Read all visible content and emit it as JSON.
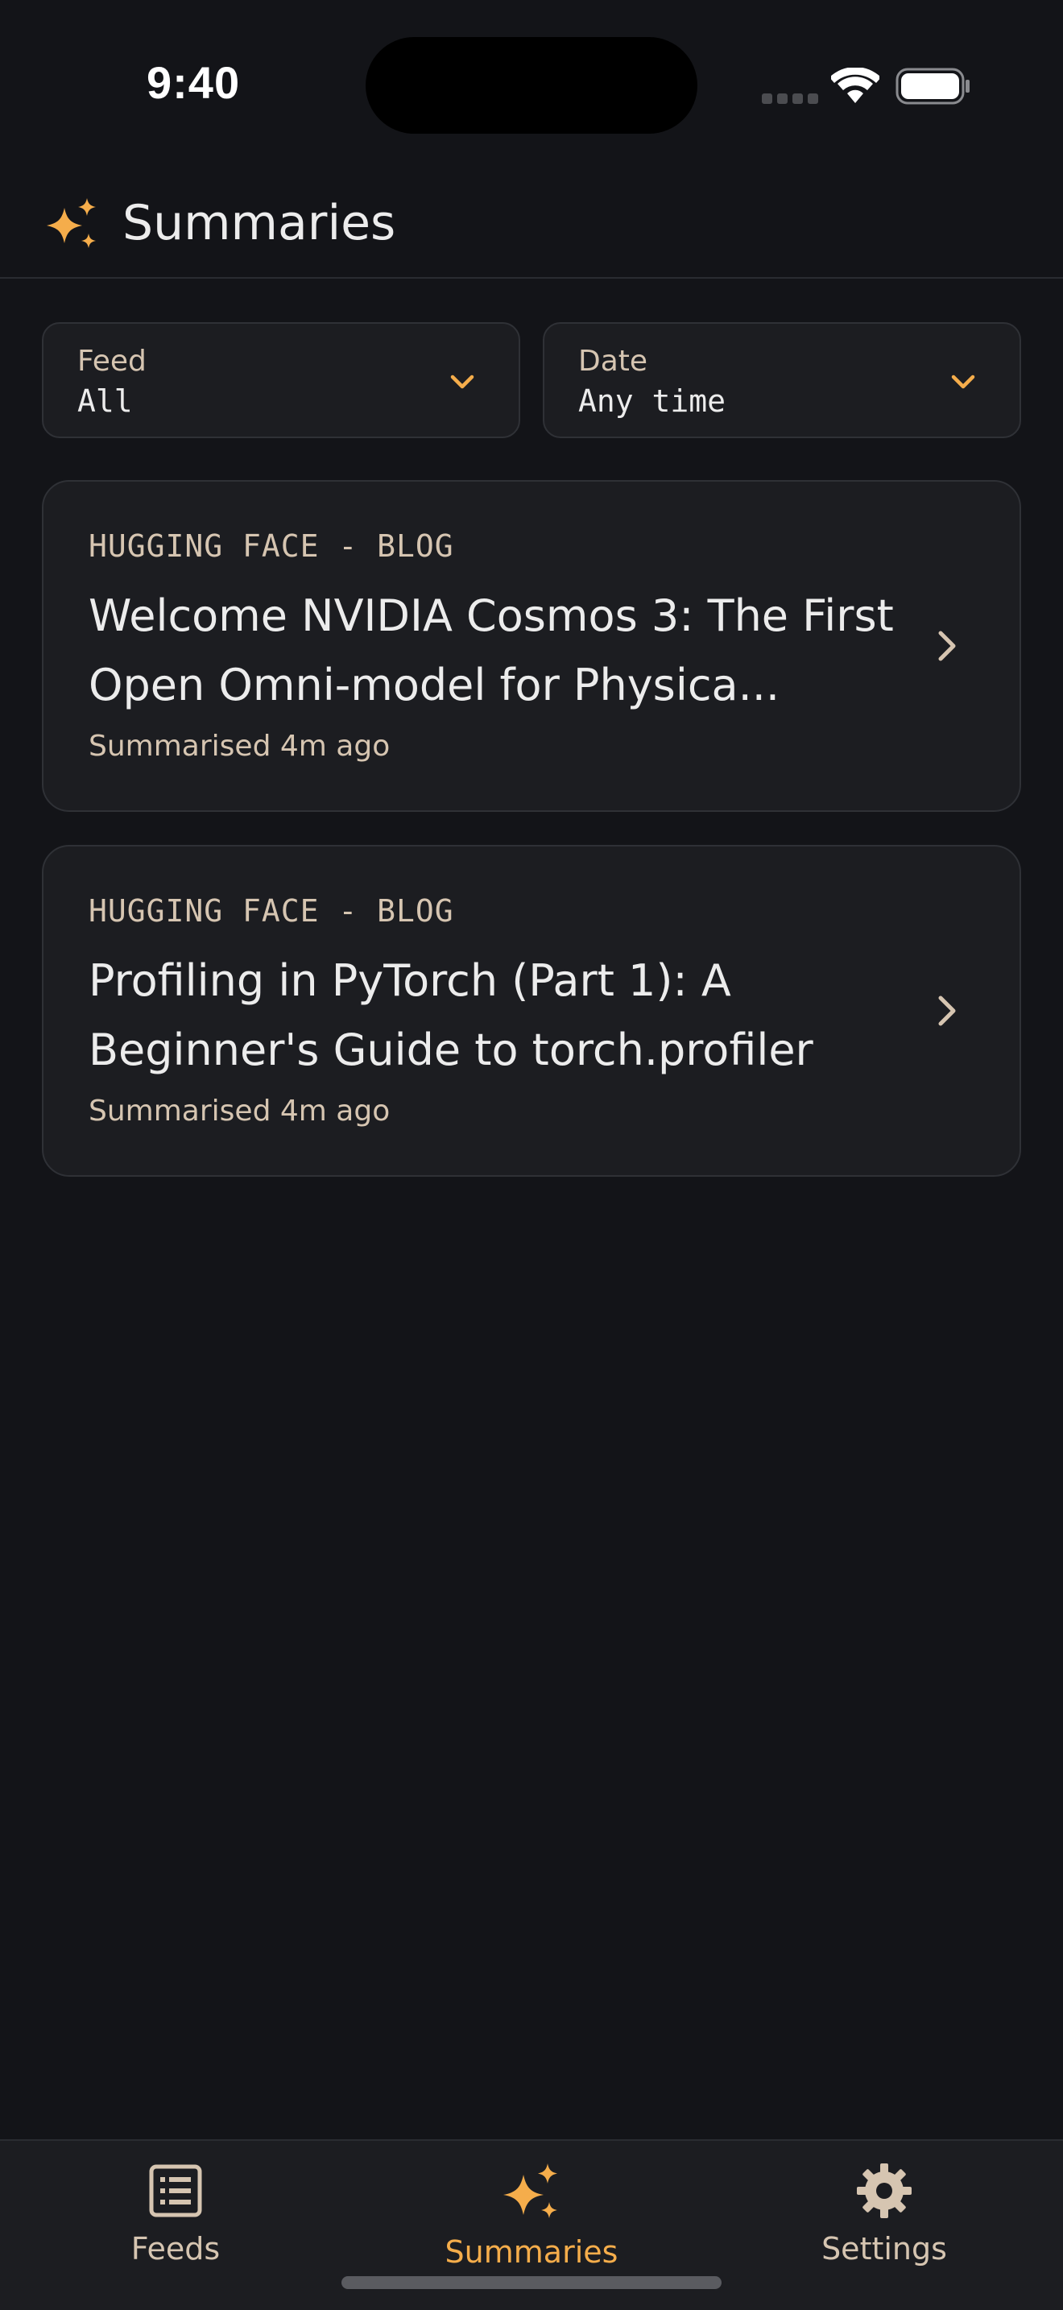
{
  "status_bar": {
    "time": "9:40",
    "icons": [
      "signal-icon",
      "wifi-icon",
      "battery-icon"
    ]
  },
  "header": {
    "icon": "sparkles-icon",
    "title": "Summaries"
  },
  "filters": {
    "feed": {
      "label": "Feed",
      "value": "All"
    },
    "date": {
      "label": "Date",
      "value": "Any time"
    }
  },
  "cards": [
    {
      "source": "HUGGING FACE - BLOG",
      "title": "Welcome NVIDIA Cosmos 3: The First Open Omni-model for Physica...",
      "meta": "Summarised 4m ago"
    },
    {
      "source": "HUGGING FACE - BLOG",
      "title": "Profiling in PyTorch (Part 1): A Beginner's Guide to torch.profiler",
      "meta": "Summarised 4m ago"
    }
  ],
  "tab_bar": {
    "tabs": [
      {
        "label": "Feeds",
        "icon": "list-icon",
        "active": false
      },
      {
        "label": "Summaries",
        "icon": "sparkles-icon",
        "active": true
      },
      {
        "label": "Settings",
        "icon": "gear-icon",
        "active": false
      }
    ]
  },
  "colors": {
    "background": "#131418",
    "card": "#1c1d21",
    "accent": "#f5ad4b",
    "muted_text": "#d6c5b1",
    "primary_text": "#ececec"
  }
}
